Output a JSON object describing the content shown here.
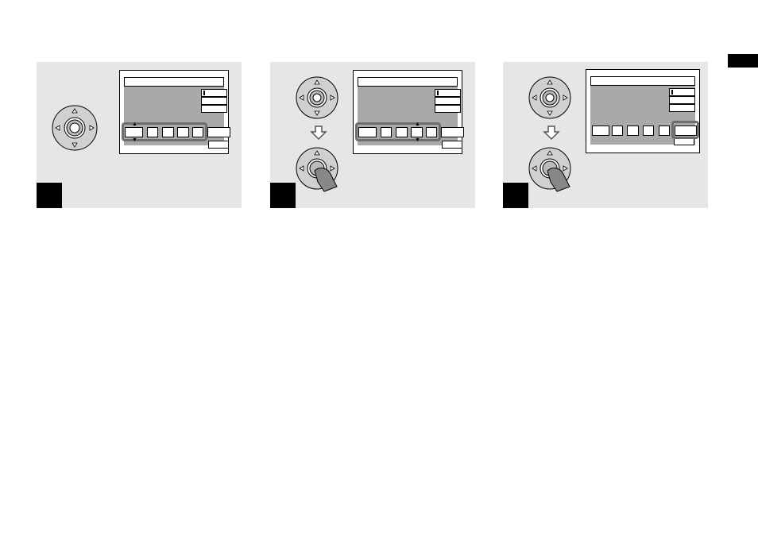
{
  "page": {
    "tab_marker_color": "#000000",
    "panel_color": "#e6e6e6"
  },
  "steps": [
    {
      "number": "",
      "action": "select-date-field",
      "icons": [
        "control-button-icon"
      ]
    },
    {
      "number": "",
      "action": "adjust-and-confirm",
      "icons": [
        "control-button-icon",
        "arrow-down-icon",
        "press-center-icon"
      ]
    },
    {
      "number": "",
      "action": "select-ok-and-confirm",
      "icons": [
        "control-button-icon",
        "arrow-down-icon",
        "press-center-icon"
      ]
    }
  ],
  "colors": {
    "screen_bg": "#a9a9a9",
    "highlight": "#6e6e6e"
  }
}
